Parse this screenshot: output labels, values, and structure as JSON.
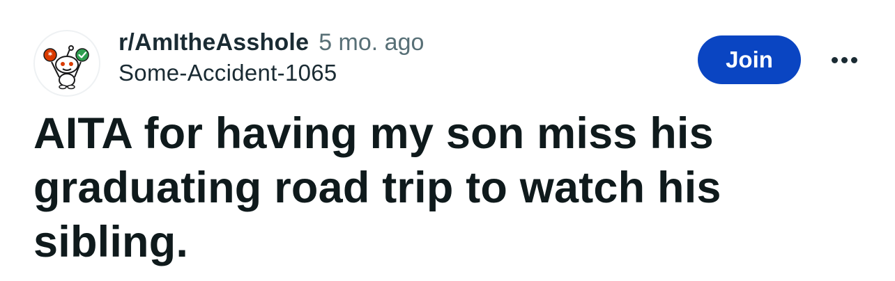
{
  "post": {
    "subreddit": "r/AmItheAsshole",
    "age": "5 mo. ago",
    "author": "Some-Accident-1065",
    "title": "AITA for having my son miss his graduating road trip to watch his sibling."
  },
  "actions": {
    "join_label": "Join",
    "more_icon": "more-horizontal-icon"
  },
  "colors": {
    "join_button": "#0a45c2",
    "text_primary": "#0f1a1c",
    "text_secondary": "#576f76",
    "avatar_badge_orange": "#d93a00",
    "avatar_badge_green": "#2e9e4f"
  }
}
